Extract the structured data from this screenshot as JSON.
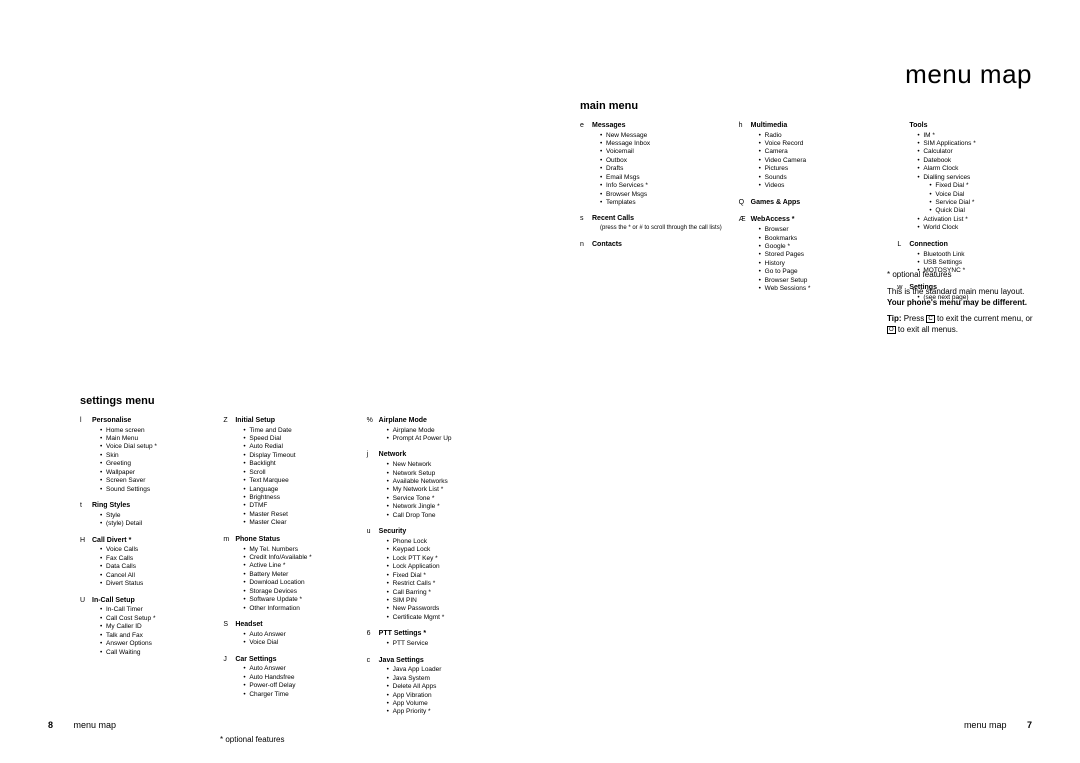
{
  "page_title": "menu map",
  "main_menu": {
    "title": "main menu",
    "cols": [
      [
        {
          "ico": "e",
          "head": "Messages",
          "items": [
            "New Message",
            "Message Inbox",
            "Voicemail",
            "Outbox",
            "Drafts",
            "Email Msgs",
            "Info Services *",
            "Browser Msgs",
            "Templates"
          ]
        },
        {
          "ico": "s",
          "head": "Recent Calls",
          "paren": "(press the * or # to scroll through the call lists)"
        },
        {
          "ico": "n",
          "head": "Contacts"
        }
      ],
      [
        {
          "ico": "h",
          "head": "Multimedia",
          "items": [
            "Radio",
            "Voice Record",
            "Camera",
            "Video Camera",
            "Pictures",
            "Sounds",
            "Videos"
          ]
        },
        {
          "ico": "Q",
          "head": "Games & Apps"
        },
        {
          "ico": "Æ",
          "head": "WebAccess *",
          "items": [
            "Browser",
            "Bookmarks",
            "Google *",
            "Stored Pages",
            "History",
            "Go to Page",
            "Browser Setup",
            "Web Sessions *"
          ]
        }
      ],
      [
        {
          "ico": "",
          "head": "Tools",
          "items": [
            "IM *",
            "SIM Applications *",
            "Calculator",
            "Datebook",
            "Alarm Clock",
            {
              "txt": "Dialling services",
              "sub": [
                "Fixed Dial *",
                "Voice Dial",
                "Service Dial *",
                "Quick Dial"
              ]
            },
            "Activation List *",
            "World Clock"
          ]
        },
        {
          "ico": "L",
          "head": "Connection",
          "items": [
            "Bluetooth Link",
            "USB Settings",
            "MOTOSYNC *"
          ]
        },
        {
          "ico": "w",
          "head": "Settings",
          "items": [
            "(see next page)"
          ]
        }
      ]
    ]
  },
  "notes": {
    "optional": "* optional features",
    "layout1": "This is the standard main menu layout. ",
    "layout2": "Your phone's menu may be different.",
    "tip_pre": "Tip: ",
    "tip_mid1": "Press ",
    "key1": "C",
    "tip_mid2": " to exit the current menu, or ",
    "key2": "O",
    "tip_end": " to exit all menus."
  },
  "footer_right": {
    "label": "menu map",
    "num": "7"
  },
  "footer_left": {
    "num": "8",
    "label": "menu map"
  },
  "settings": {
    "title": "settings menu",
    "opt": "* optional features",
    "cols": [
      [
        {
          "ico": "l",
          "head": "Personalise",
          "items": [
            "Home screen",
            "Main Menu",
            "Voice Dial setup *",
            "Skin",
            "Greeting",
            "Wallpaper",
            "Screen Saver",
            "Sound Settings"
          ]
        },
        {
          "ico": "t",
          "head": "Ring Styles",
          "items": [
            "Style",
            "(style) Detail"
          ]
        },
        {
          "ico": "H",
          "head": "Call Divert *",
          "items": [
            "Voice Calls",
            "Fax Calls",
            "Data Calls",
            "Cancel All",
            "Divert Status"
          ]
        },
        {
          "ico": "U",
          "head": "In-Call Setup",
          "items": [
            "In-Call Timer",
            "Call Cost Setup *",
            "My Caller ID",
            "Talk and Fax",
            "Answer Options",
            "Call Waiting"
          ]
        }
      ],
      [
        {
          "ico": "Z",
          "head": "Initial Setup",
          "items": [
            "Time and Date",
            "Speed Dial",
            "Auto Redial",
            "Display Timeout",
            "Backlight",
            "Scroll",
            "Text Marquee",
            "Language",
            "Brightness",
            "DTMF",
            "Master Reset",
            "Master Clear"
          ]
        },
        {
          "ico": "m",
          "head": "Phone Status",
          "items": [
            "My Tel. Numbers",
            "Credit Info/Available *",
            "Active Line *",
            "Battery Meter",
            "Download Location",
            "Storage Devices",
            "Software Update *",
            "Other Information"
          ]
        },
        {
          "ico": "S",
          "head": "Headset",
          "items": [
            "Auto Answer",
            "Voice Dial"
          ]
        },
        {
          "ico": "J",
          "head": "Car Settings",
          "items": [
            "Auto Answer",
            "Auto Handsfree",
            "Power-off Delay",
            "Charger Time"
          ]
        }
      ],
      [
        {
          "ico": "%",
          "head": "Airplane Mode",
          "items": [
            "Airplane Mode",
            "Prompt At Power Up"
          ]
        },
        {
          "ico": "j",
          "head": "Network",
          "items": [
            "New Network",
            "Network Setup",
            "Available Networks",
            "My Network List *",
            "Service Tone *",
            "Network Jingle *",
            "Call Drop Tone"
          ]
        },
        {
          "ico": "u",
          "head": "Security",
          "items": [
            "Phone Lock",
            "Keypad Lock",
            "Lock PTT Key *",
            "Lock Application",
            "Fixed Dial *",
            "Restrict Calls *",
            "Call Barring *",
            "SIM PIN",
            "New Passwords",
            "Certificate Mgmt *"
          ]
        },
        {
          "ico": "6",
          "head": "PTT Settings *",
          "items": [
            "PTT Service"
          ]
        },
        {
          "ico": "c",
          "head": "Java Settings",
          "items": [
            "Java App Loader",
            "Java System",
            "Delete All Apps",
            "App Vibration",
            "App Volume",
            "App Priority *"
          ]
        }
      ]
    ]
  }
}
